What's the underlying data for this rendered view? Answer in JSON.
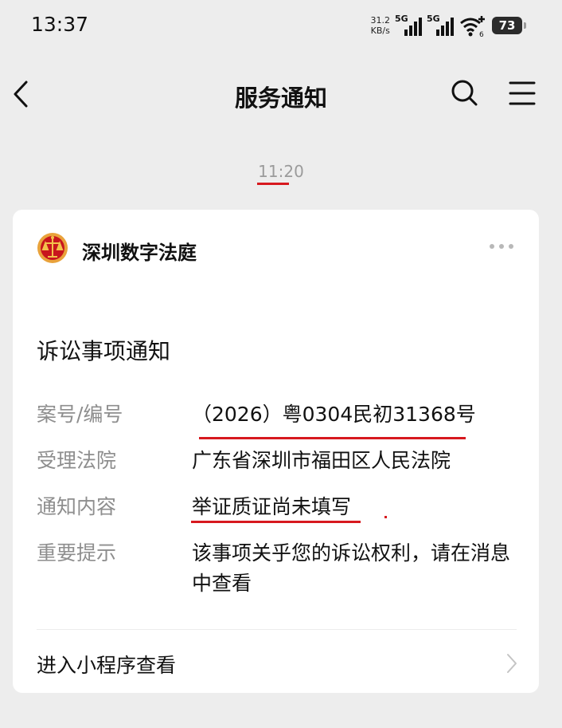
{
  "status": {
    "time": "13:37",
    "net_speed_value": "31.2",
    "net_speed_unit": "KB/s",
    "signal1_label": "5G",
    "signal2_label": "5G",
    "wifi_label": "6",
    "battery": "73"
  },
  "nav": {
    "title": "服务通知",
    "icons": [
      "back-icon",
      "search-icon",
      "menu-icon"
    ]
  },
  "timestamp": "11:20",
  "card": {
    "sender": "深圳数字法庭",
    "title": "诉讼事项通知",
    "rows": [
      {
        "label": "案号/编号",
        "value": "（2026）粤0304民初31368号"
      },
      {
        "label": "受理法院",
        "value": "广东省深圳市福田区人民法院"
      },
      {
        "label": "通知内容",
        "value": "举证质证尚未填写"
      },
      {
        "label": "重要提示",
        "value": "该事项关乎您的诉讼权利，请在消息中查看"
      }
    ],
    "footer_link": "进入小程序查看"
  },
  "colors": {
    "background": "#ededed",
    "card": "#ffffff",
    "annotation_red": "#d7191f",
    "label_gray": "#8e8e8e"
  }
}
